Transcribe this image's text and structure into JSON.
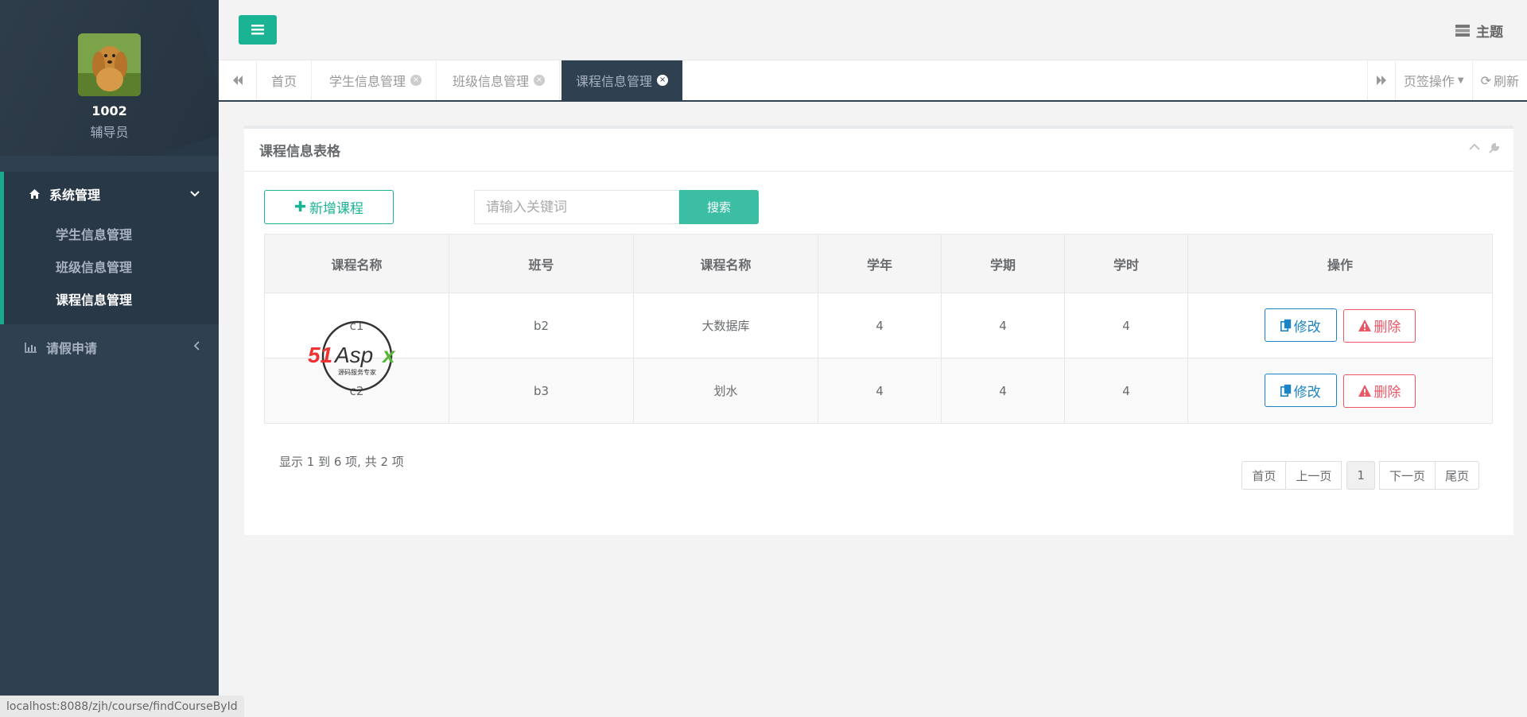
{
  "profile": {
    "name": "1002",
    "role": "辅导员"
  },
  "sidebar": {
    "system_menu": "系统管理",
    "sub_items": [
      "学生信息管理",
      "班级信息管理",
      "课程信息管理"
    ],
    "leave_menu": "请假申请"
  },
  "header": {
    "theme_label": "主题"
  },
  "tabs": {
    "items": [
      {
        "label": "首页"
      },
      {
        "label": "学生信息管理"
      },
      {
        "label": "班级信息管理"
      },
      {
        "label": "课程信息管理"
      }
    ],
    "page_ops": "页签操作",
    "refresh": "刷新"
  },
  "panel": {
    "title": "课程信息表格",
    "add_label": "新增课程",
    "search_placeholder": "请输入关键词",
    "search_label": "搜索"
  },
  "table": {
    "headers": [
      "课程名称",
      "班号",
      "课程名称",
      "学年",
      "学期",
      "学时",
      "操作"
    ],
    "rows": [
      {
        "c0": "c1",
        "c1": "b2",
        "c2": "大数据库",
        "c3": "4",
        "c4": "4",
        "c5": "4"
      },
      {
        "c0": "c2",
        "c1": "b3",
        "c2": "划水",
        "c3": "4",
        "c4": "4",
        "c5": "4"
      }
    ],
    "edit_label": "修改",
    "delete_label": "删除"
  },
  "pagination": {
    "info": "显示 1 到 6 项, 共 2 项",
    "first": "首页",
    "prev": "上一页",
    "current": "1",
    "next": "下一页",
    "last": "尾页"
  },
  "watermark": {
    "brand": "51Aspx",
    "tagline": "源码服务专家"
  },
  "status_url": "localhost:8088/zjh/course/findCourseById",
  "colors": {
    "sidebar": "#2f4050",
    "accent": "#1ab394",
    "edit": "#1c84c6",
    "delete": "#ed5565"
  }
}
